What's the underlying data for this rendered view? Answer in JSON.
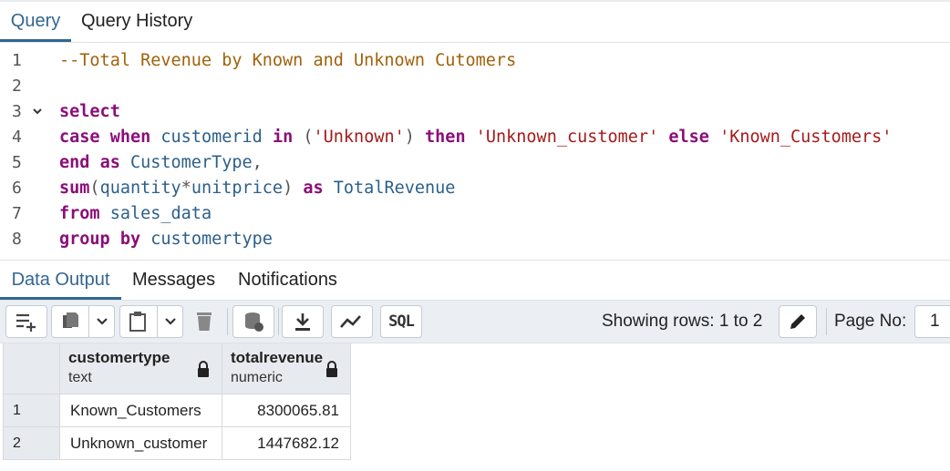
{
  "query_tabs": [
    {
      "label": "Query",
      "active": true
    },
    {
      "label": "Query History",
      "active": false
    }
  ],
  "editor": {
    "lines": [
      {
        "number": "1",
        "fold": ""
      },
      {
        "number": "2",
        "fold": ""
      },
      {
        "number": "3",
        "fold": "chevron-down"
      },
      {
        "number": "4",
        "fold": ""
      },
      {
        "number": "5",
        "fold": ""
      },
      {
        "number": "6",
        "fold": ""
      },
      {
        "number": "7",
        "fold": ""
      },
      {
        "number": "8",
        "fold": ""
      }
    ],
    "tokens": {
      "l1": [
        "--Total Revenue by Known and Unknown Cutomers"
      ],
      "l3": [
        "select"
      ],
      "l4": [
        "case",
        " ",
        "when",
        " ",
        "customerid",
        " ",
        "in",
        " ",
        "(",
        "'Unknown'",
        ")",
        " ",
        "then",
        " ",
        "'Unknown_customer'",
        " ",
        "else",
        " ",
        "'Known_Customers'"
      ],
      "l5": [
        "end",
        " ",
        "as",
        " ",
        "CustomerType",
        ","
      ],
      "l6": [
        "sum",
        "(",
        "quantity",
        "*",
        "unitprice",
        ")",
        " ",
        "as",
        " ",
        "TotalRevenue"
      ],
      "l7": [
        "from",
        " ",
        "sales_data"
      ],
      "l8": [
        "group",
        " ",
        "by",
        " ",
        "customertype"
      ]
    },
    "colors": {
      "keyword": "#8a0e78",
      "identifier": "#2c5f8a",
      "string": "#a41b1b",
      "comment": "#a0620a"
    }
  },
  "output_tabs": [
    {
      "label": "Data Output",
      "active": true
    },
    {
      "label": "Messages",
      "active": false
    },
    {
      "label": "Notifications",
      "active": false
    }
  ],
  "toolbar": {
    "icons": [
      "add-row-icon",
      "copy-icon",
      "chevron-down-icon",
      "paste-icon",
      "chevron-down-icon",
      "delete-icon",
      "save-data-icon",
      "download-icon",
      "graph-icon",
      "sql-icon",
      "edit-icon"
    ],
    "sql_label": "SQL",
    "rows_text": "Showing rows: 1 to 2",
    "page_label": "Page No:",
    "page_value": "1"
  },
  "grid": {
    "columns": [
      {
        "name": "customertype",
        "type": "text"
      },
      {
        "name": "totalrevenue",
        "type": "numeric"
      }
    ],
    "rows": [
      {
        "num": "1",
        "customertype": "Known_Customers",
        "totalrevenue": "8300065.81"
      },
      {
        "num": "2",
        "customertype": "Unknown_customer",
        "totalrevenue": "1447682.12"
      }
    ]
  },
  "accent": "#326690"
}
